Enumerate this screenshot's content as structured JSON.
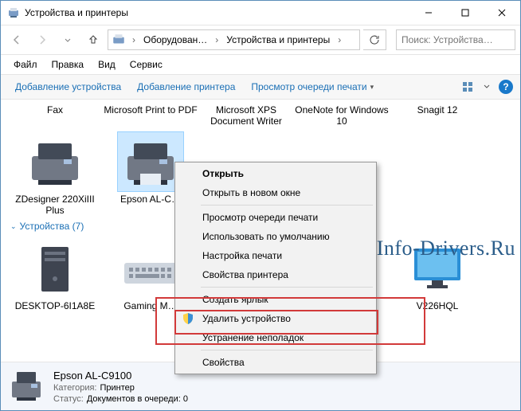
{
  "window": {
    "title": "Устройства и принтеры"
  },
  "nav": {
    "breadcrumb": [
      "Оборудован…",
      "Устройства и принтеры"
    ],
    "search_placeholder": "Поиск: Устройства…"
  },
  "menubar": [
    "Файл",
    "Правка",
    "Вид",
    "Сервис"
  ],
  "toolbar": {
    "add_device": "Добавление устройства",
    "add_printer": "Добавление принтера",
    "view_queue": "Просмотр очереди печати"
  },
  "printers_row_labels": [
    "Fax",
    "Microsoft Print to PDF",
    "Microsoft XPS Document Writer",
    "OneNote for Windows 10",
    "Snagit 12"
  ],
  "printers_row2_labels": [
    "ZDesigner 220XiIII Plus",
    "Epson AL-C…"
  ],
  "group_devices": "Устройства (7)",
  "devices_row_labels": [
    "DESKTOP-6I1A8E",
    "Gaming M…",
    "",
    "",
    "V226HQL"
  ],
  "context_menu": {
    "open": "Открыть",
    "open_new": "Открыть в новом окне",
    "view_queue": "Просмотр очереди печати",
    "set_default": "Использовать по умолчанию",
    "print_settings": "Настройка печати",
    "printer_props": "Свойства принтера",
    "create_shortcut": "Создать ярлык",
    "remove_device": "Удалить устройство",
    "troubleshoot": "Устранение неполадок",
    "properties": "Свойства"
  },
  "details": {
    "name": "Epson AL-C9100",
    "category_label": "Категория:",
    "category_value": "Принтер",
    "status_label": "Статус:",
    "status_value": "Документов в очереди: 0"
  },
  "watermark": "Info-Drivers.Ru"
}
